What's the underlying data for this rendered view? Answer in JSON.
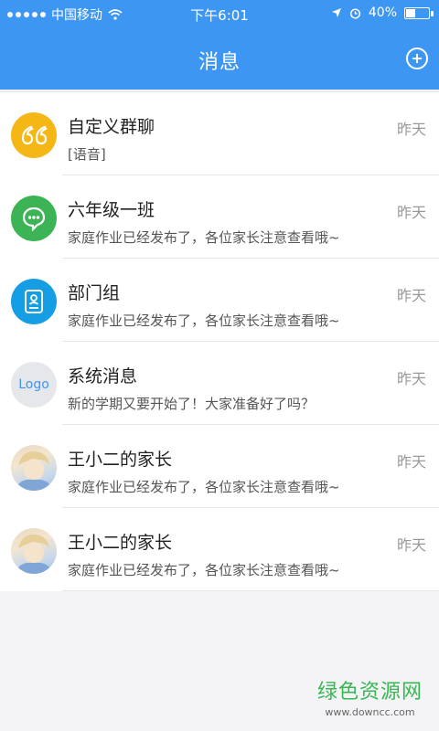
{
  "status_bar": {
    "carrier": "中国移动",
    "time": "下午6:01",
    "battery_text": "40%",
    "battery_level": 0.4
  },
  "nav": {
    "title": "消息"
  },
  "conversations": [
    {
      "name": "自定义群聊",
      "preview": "[语音]",
      "time": "昨天",
      "avatar": "quote-icon"
    },
    {
      "name": "六年级一班",
      "preview": "家庭作业已经发布了，各位家长注意查看哦~",
      "time": "昨天",
      "avatar": "chat-bubble-icon"
    },
    {
      "name": "部门组",
      "preview": "家庭作业已经发布了，各位家长注意查看哦~",
      "time": "昨天",
      "avatar": "id-card-icon"
    },
    {
      "name": "系统消息",
      "preview": "新的学期又要开始了！大家准备好了吗？",
      "time": "昨天",
      "avatar": "Logo"
    },
    {
      "name": "王小二的家长",
      "preview": "家庭作业已经发布了，各位家长注意查看哦~",
      "time": "昨天",
      "avatar": "user-photo"
    },
    {
      "name": "王小二的家长",
      "preview": "家庭作业已经发布了，各位家长注意查看哦~",
      "time": "昨天",
      "avatar": "user-photo"
    }
  ],
  "watermark": {
    "line1": "绿色资源网",
    "line2": "www.downcc.com"
  },
  "colors": {
    "accent": "#3d97f2",
    "yellow": "#f5b715",
    "green": "#3cb455",
    "blue": "#169ee5"
  }
}
